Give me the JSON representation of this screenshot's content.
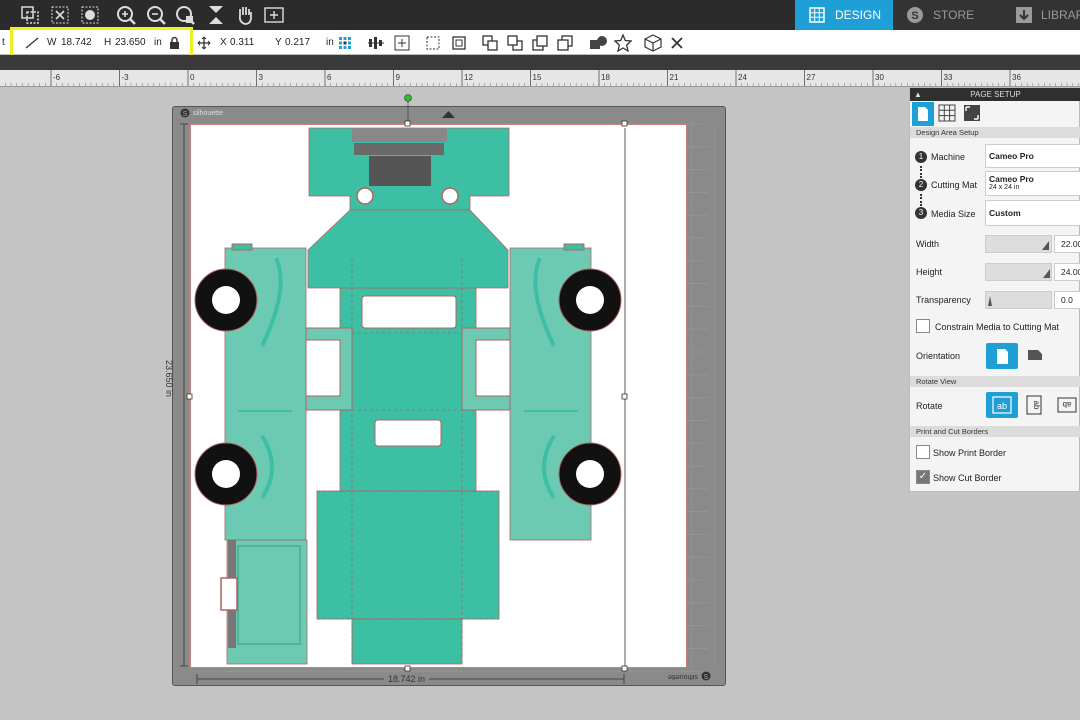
{
  "tabs": [
    {
      "label": "DESIGN",
      "icon": "grid-icon",
      "active": true
    },
    {
      "label": "STORE",
      "icon": "silhouette-s-icon",
      "active": false
    },
    {
      "label": "LIBRAR",
      "icon": "download-icon",
      "active": false
    }
  ],
  "toolbar2": {
    "cut_label": "t",
    "w_label": "W",
    "w_value": "18.742",
    "h_label": "H",
    "h_value": "23.650",
    "unit": "in",
    "x_label": "X",
    "x_value": "0.311",
    "y_label": "Y",
    "y_value": "0.217",
    "unit2": "in"
  },
  "ruler": {
    "ticks": [
      "-6",
      "-3",
      "0",
      "3",
      "6",
      "9",
      "12",
      "15",
      "18",
      "21",
      "24",
      "27",
      "30",
      "33",
      "36"
    ]
  },
  "mat": {
    "brand": "silhouette",
    "brand_bottom": "silhouette",
    "height_label": "23.650 in",
    "width_label": "18.742 in"
  },
  "panel": {
    "title": "PAGE SETUP",
    "section1": "Design Area Setup",
    "machine_label": "Machine",
    "machine_value": "Cameo Pro",
    "mat_label": "Cutting Mat",
    "mat_value": "Cameo Pro",
    "mat_sub": "24 x 24 in",
    "media_label": "Media Size",
    "media_value": "Custom",
    "width_label": "Width",
    "width_value": "22.00",
    "height_label": "Height",
    "height_value": "24.00",
    "transparency_label": "Transparency",
    "transparency_value": "0.0",
    "constrain_label": "Constrain Media to Cutting Mat",
    "orientation_label": "Orientation",
    "section2": "Rotate View",
    "rotate_label": "Rotate",
    "section3": "Print and Cut Borders",
    "print_border_label": "Show Print Border",
    "cut_border_label": "Show Cut Border",
    "step1": "1",
    "step2": "2",
    "step3": "3"
  },
  "colors": {
    "accent": "#1e9fd6",
    "teal": "#3dbfa4",
    "teal_light": "#6ccab3",
    "highlight": "#f0f020"
  }
}
